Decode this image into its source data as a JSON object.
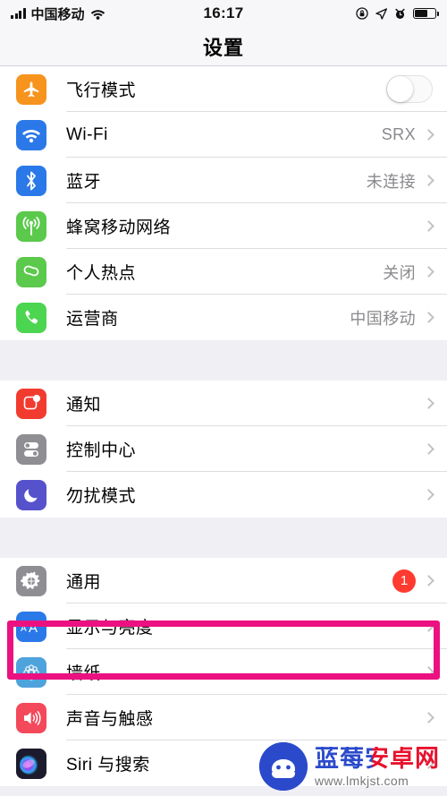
{
  "status_bar": {
    "carrier": "中国移动",
    "time": "16:17",
    "icons_left": [
      "signal-bars-icon",
      "wifi-icon"
    ],
    "icons_right": [
      "rotation-lock-icon",
      "location-arrow-icon",
      "alarm-clock-icon",
      "battery-icon"
    ],
    "battery_level_percent": 62
  },
  "nav": {
    "title": "设置"
  },
  "groups": [
    {
      "rows": [
        {
          "icon": "airplane-icon",
          "icon_color": "#F7941D",
          "label": "飞行模式",
          "accessory": "toggle",
          "toggle_on": false
        },
        {
          "icon": "wifi-icon",
          "icon_color": "#2B79E8",
          "label": "Wi-Fi",
          "value": "SRX",
          "accessory": "chevron"
        },
        {
          "icon": "bluetooth-icon",
          "icon_color": "#2B79E8",
          "label": "蓝牙",
          "value": "未连接",
          "accessory": "chevron"
        },
        {
          "icon": "cellular-antenna-icon",
          "icon_color": "#5BC94B",
          "label": "蜂窝移动网络",
          "value": "",
          "accessory": "chevron"
        },
        {
          "icon": "hotspot-icon",
          "icon_color": "#5BC94B",
          "label": "个人热点",
          "value": "关闭",
          "accessory": "chevron"
        },
        {
          "icon": "phone-icon",
          "icon_color": "#4CD551",
          "label": "运营商",
          "value": "中国移动",
          "accessory": "chevron"
        }
      ]
    },
    {
      "rows": [
        {
          "icon": "notifications-icon",
          "icon_color": "#F23B2F",
          "label": "通知",
          "value": "",
          "accessory": "chevron"
        },
        {
          "icon": "control-center-icon",
          "icon_color": "#8E8E93",
          "label": "控制中心",
          "value": "",
          "accessory": "chevron"
        },
        {
          "icon": "do-not-disturb-moon-icon",
          "icon_color": "#5652CC",
          "label": "勿扰模式",
          "value": "",
          "accessory": "chevron"
        }
      ]
    },
    {
      "rows": [
        {
          "icon": "gear-icon",
          "icon_color": "#8E8E93",
          "label": "通用",
          "badge": "1",
          "accessory": "chevron"
        },
        {
          "icon": "display-brightness-aa-icon",
          "icon_color": "#2B79E8",
          "label": "显示与亮度",
          "value": "",
          "accessory": "chevron",
          "highlighted": true
        },
        {
          "icon": "wallpaper-flower-icon",
          "icon_color": "#4FA3DC",
          "label": "墙纸",
          "value": "",
          "accessory": "chevron"
        },
        {
          "icon": "sounds-speaker-icon",
          "icon_color": "#F4485B",
          "label": "声音与触感",
          "value": "",
          "accessory": "chevron"
        },
        {
          "icon": "siri-orb-icon",
          "icon_color": "#1C1B2E",
          "label": "Siri 与搜索",
          "value": "",
          "accessory": "chevron"
        }
      ]
    }
  ],
  "highlight": {
    "color": "#EC1180",
    "target_label": "显示与亮度"
  },
  "watermark": {
    "title": "蓝莓安卓网",
    "url": "www.lmkjst.com",
    "logo": "android-mascot-icon"
  }
}
